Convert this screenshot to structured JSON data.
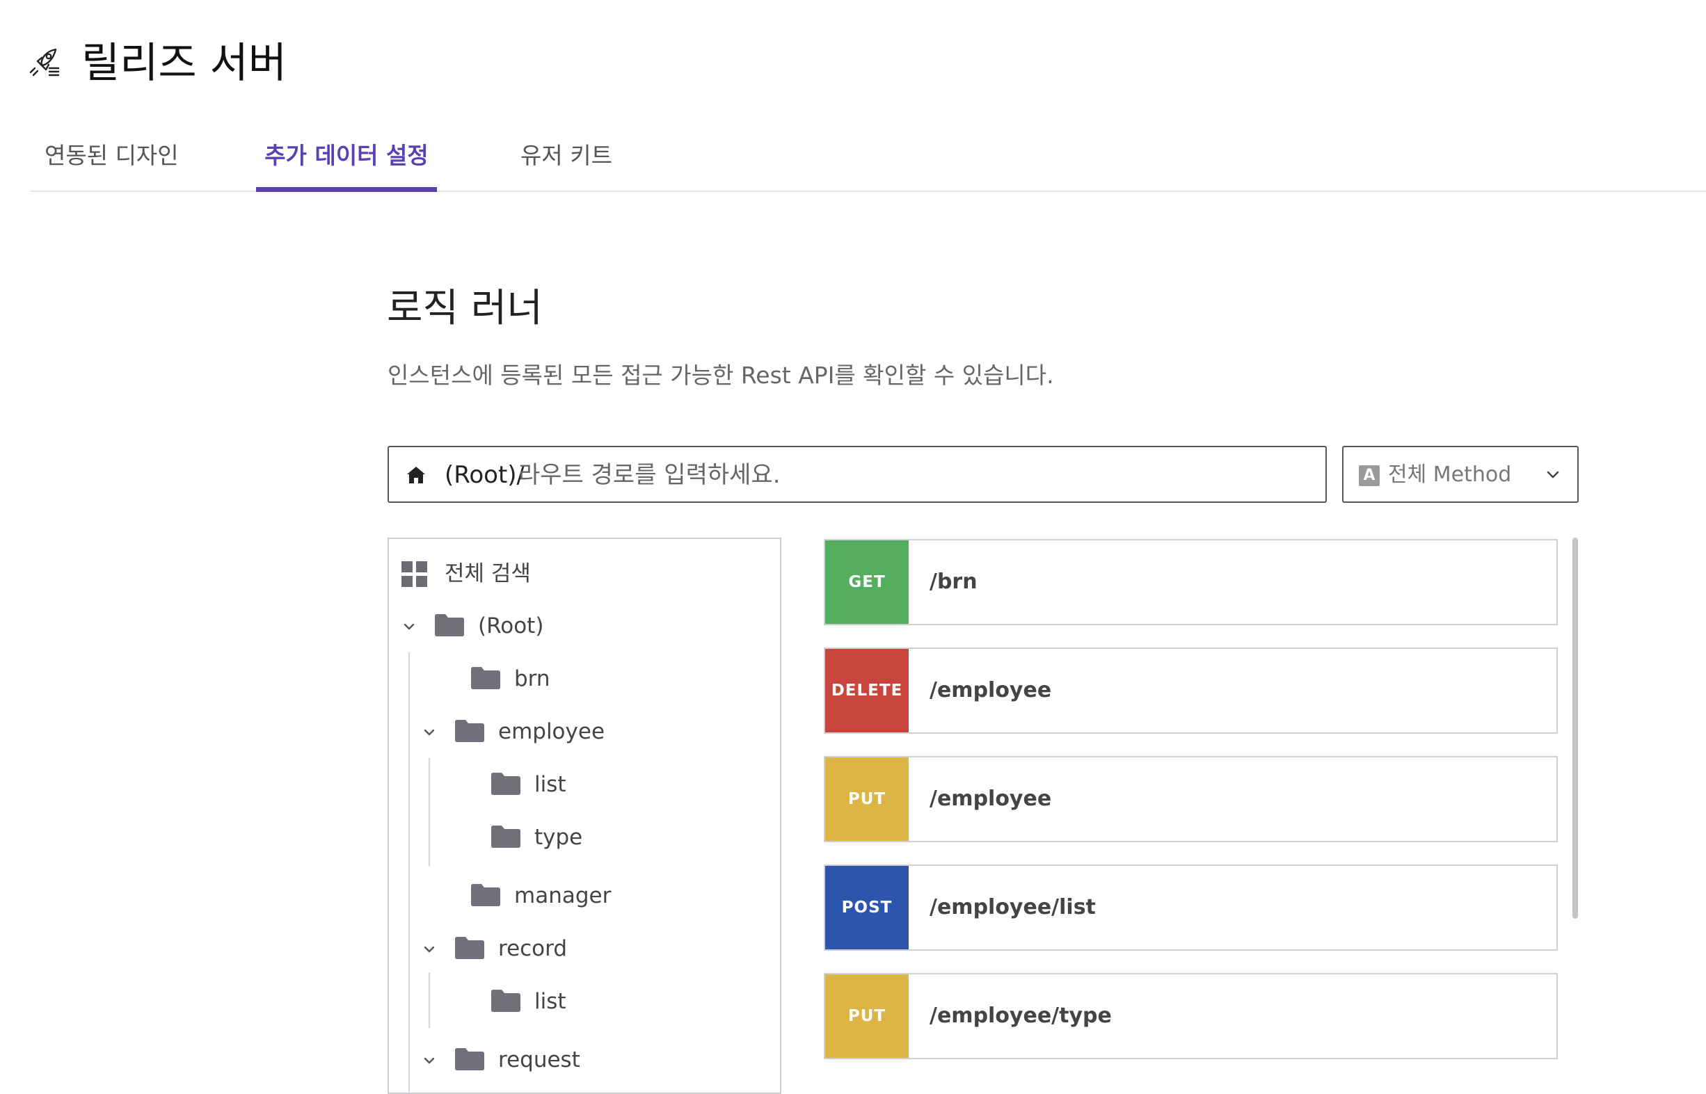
{
  "header": {
    "title": "릴리즈 서버",
    "icon": "rocket-icon"
  },
  "tabs": [
    {
      "label": "연동된 디자인",
      "active": false
    },
    {
      "label": "추가 데이터 설정",
      "active": true
    },
    {
      "label": "유저 키트",
      "active": false
    }
  ],
  "section": {
    "title": "로직 러너",
    "description": "인스턴스에 등록된 모든 접근 가능한 Rest API를 확인할 수 있습니다."
  },
  "route_input": {
    "prefix": "(Root)/",
    "placeholder": "라우트 경로를 입력하세요.",
    "value": ""
  },
  "method_select": {
    "badge": "A",
    "selected": "전체 Method"
  },
  "tree": {
    "search_all": "전체 검색",
    "nodes": [
      {
        "label": "(Root)",
        "expanded": true
      },
      {
        "label": "brn"
      },
      {
        "label": "employee",
        "expanded": true
      },
      {
        "label": "list"
      },
      {
        "label": "type"
      },
      {
        "label": "manager"
      },
      {
        "label": "record",
        "expanded": true
      },
      {
        "label": "list"
      },
      {
        "label": "request",
        "expanded": true
      }
    ]
  },
  "endpoints": [
    {
      "method": "GET",
      "path": "/brn",
      "color": "#55ad5f"
    },
    {
      "method": "DELETE",
      "path": "/employee",
      "color": "#c8453e"
    },
    {
      "method": "PUT",
      "path": "/employee",
      "color": "#ddb546"
    },
    {
      "method": "POST",
      "path": "/employee/list",
      "color": "#2d55ad"
    },
    {
      "method": "PUT",
      "path": "/employee/type",
      "color": "#ddb546"
    }
  ],
  "colors": {
    "accent": "#5a40b5",
    "folder": "#707078"
  }
}
